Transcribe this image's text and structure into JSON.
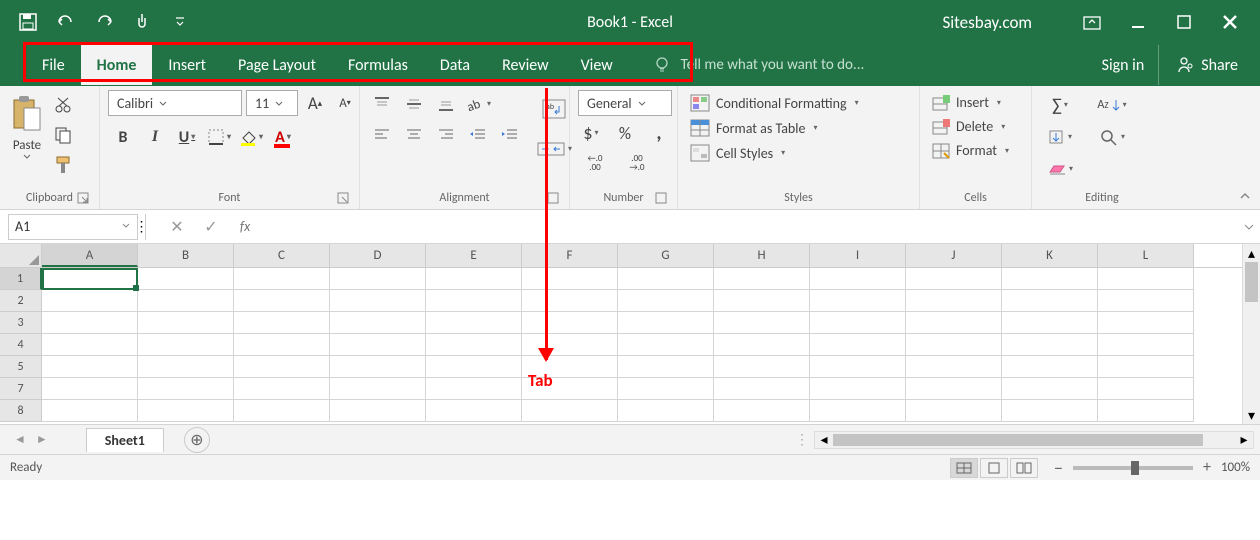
{
  "titlebar": {
    "title": "Book1 - Excel",
    "site": "Sitesbay.com"
  },
  "tabs": [
    "File",
    "Home",
    "Insert",
    "Page Layout",
    "Formulas",
    "Data",
    "Review",
    "View"
  ],
  "active_tab": "Home",
  "tellme": "Tell me what you want to do...",
  "account": {
    "signin": "Sign in",
    "share": "Share"
  },
  "ribbon": {
    "clipboard": {
      "label": "Clipboard",
      "paste": "Paste"
    },
    "font": {
      "label": "Font",
      "name": "Calibri",
      "size": "11",
      "bold": "B",
      "italic": "I",
      "underline": "U"
    },
    "alignment": {
      "label": "Alignment"
    },
    "number": {
      "label": "Number",
      "format": "General",
      "inc": ".0",
      "dec": ".00",
      "inc2": ".00",
      "dec2": ".0"
    },
    "styles": {
      "label": "Styles",
      "cf": "Conditional Formatting",
      "fat": "Format as Table",
      "cs": "Cell Styles"
    },
    "cells": {
      "label": "Cells",
      "insert": "Insert",
      "delete": "Delete",
      "format": "Format"
    },
    "editing": {
      "label": "Editing"
    }
  },
  "formula": {
    "name": "A1"
  },
  "columns": [
    "A",
    "B",
    "C",
    "D",
    "E",
    "F",
    "G",
    "H",
    "I",
    "J",
    "K",
    "L"
  ],
  "rows": [
    "1",
    "2",
    "3",
    "4",
    "5",
    "7",
    "8"
  ],
  "annotation": "Tab",
  "sheet": {
    "name": "Sheet1"
  },
  "status": {
    "ready": "Ready",
    "zoom": "100%"
  }
}
